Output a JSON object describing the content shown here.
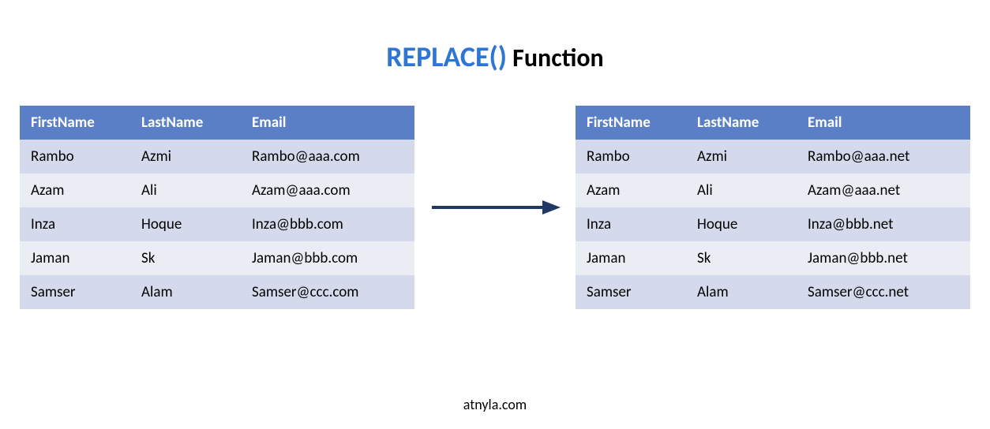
{
  "title": {
    "highlight": "REPLACE()",
    "suffix": " Function"
  },
  "headers": {
    "firstName": "FirstName",
    "lastName": "LastName",
    "email": "Email"
  },
  "leftTable": {
    "rows": [
      {
        "first": "Rambo",
        "last": "Azmi",
        "email": "Rambo@aaa.com"
      },
      {
        "first": "Azam",
        "last": "Ali",
        "email": "Azam@aaa.com"
      },
      {
        "first": "Inza",
        "last": "Hoque",
        "email": "Inza@bbb.com"
      },
      {
        "first": "Jaman",
        "last": "Sk",
        "email": "Jaman@bbb.com"
      },
      {
        "first": "Samser",
        "last": "Alam",
        "email": "Samser@ccc.com"
      }
    ]
  },
  "rightTable": {
    "rows": [
      {
        "first": "Rambo",
        "last": "Azmi",
        "email": "Rambo@aaa.net"
      },
      {
        "first": "Azam",
        "last": "Ali",
        "email": "Azam@aaa.net"
      },
      {
        "first": "Inza",
        "last": "Hoque",
        "email": "Inza@bbb.net"
      },
      {
        "first": "Jaman",
        "last": "Sk",
        "email": "Jaman@bbb.net"
      },
      {
        "first": "Samser",
        "last": "Alam",
        "email": "Samser@ccc.net"
      }
    ]
  },
  "footer": "atnyla.com"
}
